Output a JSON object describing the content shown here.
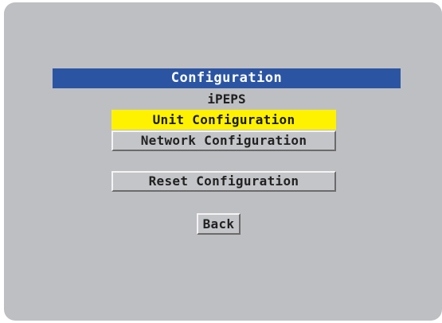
{
  "menu": {
    "title": "Configuration",
    "subtitle": "iPEPS",
    "items": [
      {
        "label": "Unit Configuration",
        "selected": true
      },
      {
        "label": "Network Configuration",
        "selected": false
      },
      {
        "label": "Reset Configuration",
        "selected": false
      }
    ],
    "back_label": "Back"
  },
  "colors": {
    "screen_bg": "#bebfc3",
    "title_bar": "#2b55a3",
    "selected_highlight": "#fff200",
    "button_bg": "#c4c5c9"
  }
}
